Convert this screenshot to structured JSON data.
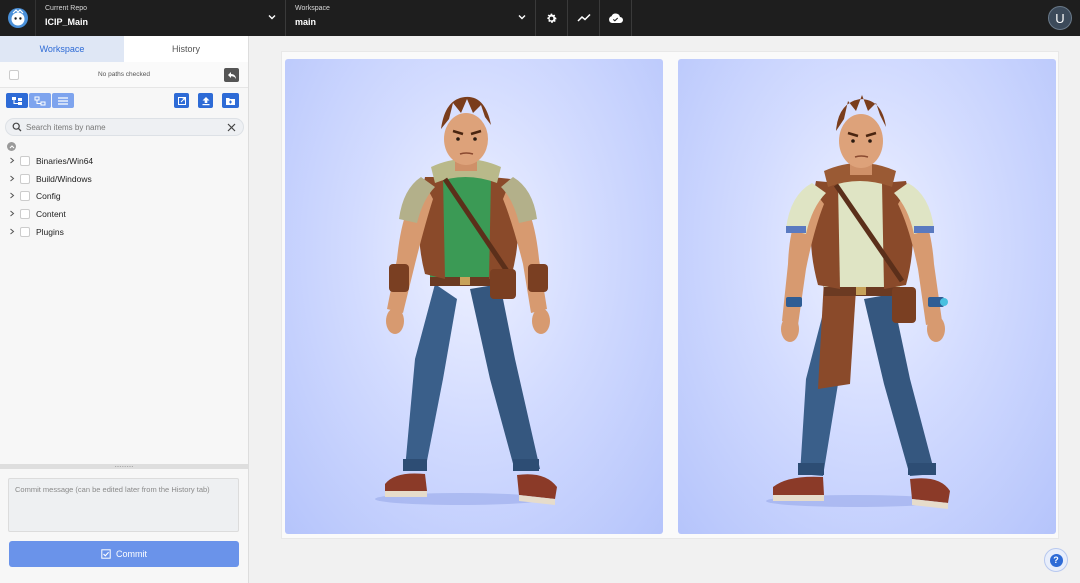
{
  "topbar": {
    "repo_caption": "Current Repo",
    "repo_value": "ICIP_Main",
    "workspace_caption": "Workspace",
    "workspace_value": "main",
    "avatar_letter": "U"
  },
  "left_panel": {
    "tabs": [
      {
        "label": "Workspace",
        "active": true
      },
      {
        "label": "History",
        "active": false
      }
    ],
    "paths_status": "No paths checked",
    "search_placeholder": "Search items by name",
    "tree_items": [
      {
        "label": "Binaries/Win64"
      },
      {
        "label": "Build/Windows"
      },
      {
        "label": "Config"
      },
      {
        "label": "Content"
      },
      {
        "label": "Plugins"
      }
    ],
    "commit_placeholder": "Commit message (can be edited later from the History tab)",
    "commit_label": "Commit"
  },
  "main": {
    "images": [
      {
        "icon": "character-image-green-shirt"
      },
      {
        "icon": "character-image-cream-shirt"
      }
    ],
    "help_glyph": "?"
  },
  "colors": {
    "accent": "#2e6bd6",
    "commit_button": "#6a93ea",
    "topbar": "#1e1e1e"
  }
}
